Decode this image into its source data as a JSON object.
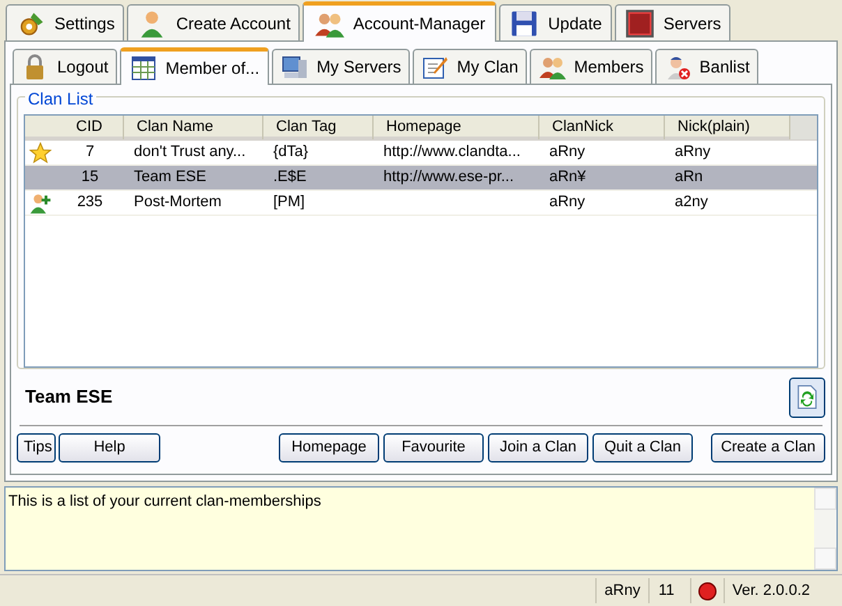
{
  "main_tabs": [
    {
      "label": "Settings",
      "selected": false
    },
    {
      "label": "Create Account",
      "selected": false
    },
    {
      "label": "Account-Manager",
      "selected": true
    },
    {
      "label": "Update",
      "selected": false
    },
    {
      "label": "Servers",
      "selected": false
    }
  ],
  "sub_tabs": [
    {
      "label": "Logout",
      "selected": false
    },
    {
      "label": "Member of...",
      "selected": true
    },
    {
      "label": "My Servers",
      "selected": false
    },
    {
      "label": "My Clan",
      "selected": false
    },
    {
      "label": "Members",
      "selected": false
    },
    {
      "label": "Banlist",
      "selected": false
    }
  ],
  "clan_list": {
    "title": "Clan List",
    "columns": [
      "CID",
      "Clan Name",
      "Clan Tag",
      "Homepage",
      "ClanNick",
      "Nick(plain)"
    ],
    "rows": [
      {
        "kind": "favourite",
        "selected": false,
        "cells": [
          "7",
          "don't Trust any...",
          "{dTa}",
          "http://www.clandta...",
          "aRny",
          "aRny"
        ]
      },
      {
        "kind": "plain",
        "selected": true,
        "cells": [
          "15",
          "Team ESE",
          ".E$E",
          "http://www.ese-pr...",
          "aRn¥",
          "aRn"
        ]
      },
      {
        "kind": "joined",
        "selected": false,
        "cells": [
          "235",
          "Post-Mortem",
          "[PM]",
          "",
          "aRny",
          "a2ny"
        ]
      }
    ]
  },
  "selected_clan": "Team ESE",
  "left_buttons": [
    "Tips",
    "Help"
  ],
  "right_buttons": [
    "Homepage",
    "Favourite",
    "Join a Clan",
    "Quit a Clan"
  ],
  "create_button": "Create a Clan",
  "info_text": "This is a list of your current clan-memberships",
  "status_bar": {
    "user": "aRny",
    "count": "11",
    "connected": false,
    "version": "Ver. 2.0.0.2"
  }
}
